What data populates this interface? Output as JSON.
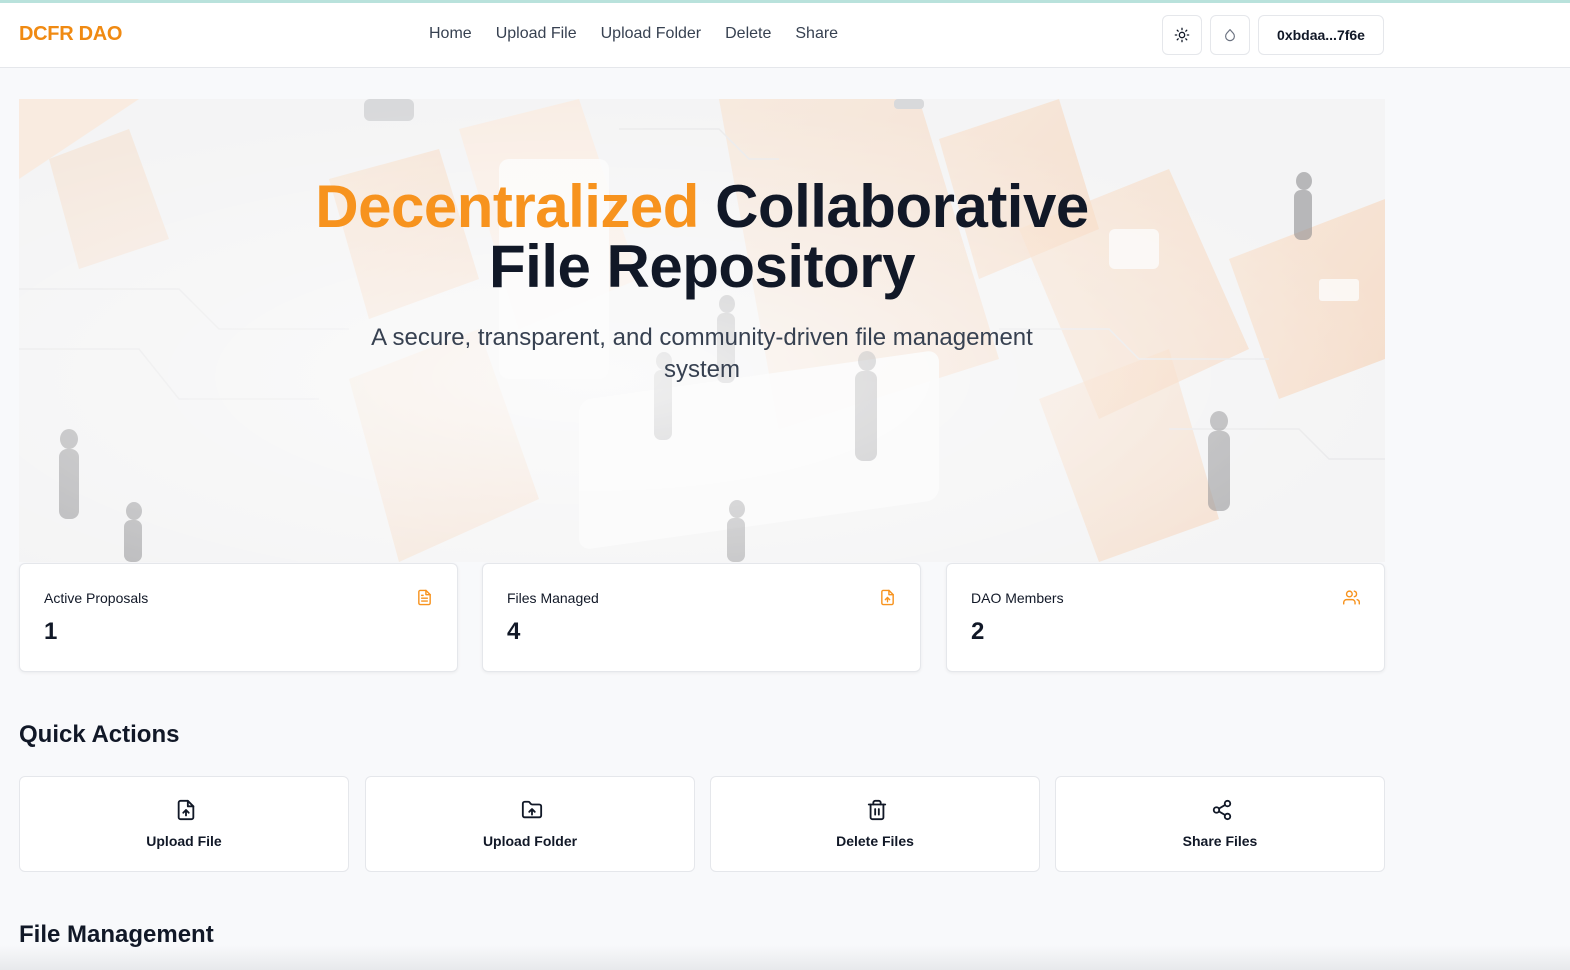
{
  "app": {
    "brand": "DCFR DAO",
    "accent_color": "#f7931e"
  },
  "nav": {
    "links": [
      "Home",
      "Upload File",
      "Upload Folder",
      "Delete",
      "Share"
    ],
    "theme_icon": "sun-icon",
    "network_icon": "droplet-icon",
    "wallet_address": "0xbdaa...7f6e"
  },
  "hero": {
    "title_accent": "Decentralized",
    "title_rest_line1": "Collaborative",
    "title_line2": "File Repository",
    "subtitle": "A secure, transparent, and community-driven file management system"
  },
  "stats": [
    {
      "label": "Active Proposals",
      "value": "1",
      "icon": "file-text-icon"
    },
    {
      "label": "Files Managed",
      "value": "4",
      "icon": "file-upload-icon"
    },
    {
      "label": "DAO Members",
      "value": "2",
      "icon": "users-icon"
    }
  ],
  "quick_actions": {
    "title": "Quick Actions",
    "items": [
      {
        "label": "Upload File",
        "icon": "file-upload-icon"
      },
      {
        "label": "Upload Folder",
        "icon": "folder-upload-icon"
      },
      {
        "label": "Delete Files",
        "icon": "trash-icon"
      },
      {
        "label": "Share Files",
        "icon": "share-icon"
      }
    ]
  },
  "file_management": {
    "title": "File Management"
  }
}
